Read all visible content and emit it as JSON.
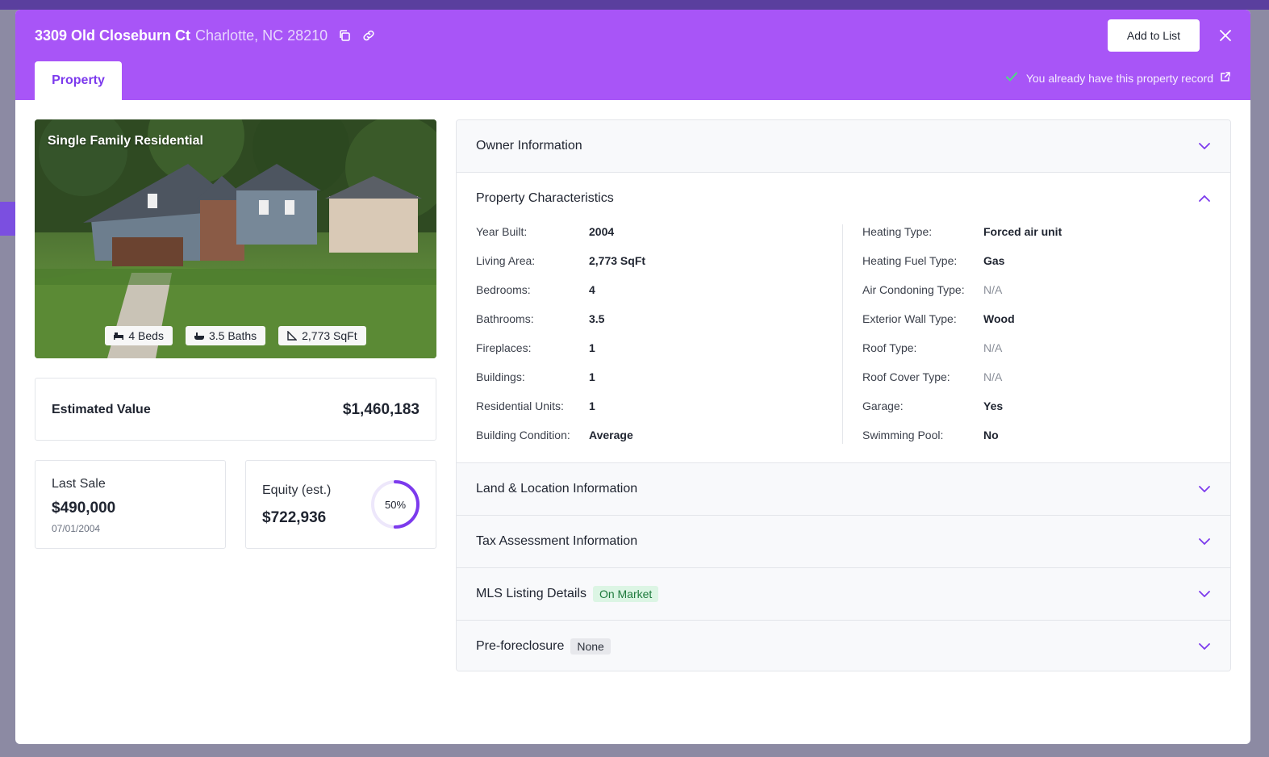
{
  "header": {
    "address": "3309 Old Closeburn Ct",
    "city_state_zip": "Charlotte, NC 28210",
    "add_to_list_label": "Add to List",
    "tab_property": "Property",
    "record_note": "You already have this property record",
    "colors": {
      "header_bg": "#a855f7",
      "accent": "#7c3aed"
    }
  },
  "photo": {
    "type_label": "Single Family Residential",
    "beds": "4 Beds",
    "baths": "3.5 Baths",
    "sqft": "2,773 SqFt"
  },
  "estimated": {
    "label": "Estimated Value",
    "value": "$1,460,183"
  },
  "last_sale": {
    "label": "Last Sale",
    "value": "$490,000",
    "date": "07/01/2004"
  },
  "equity": {
    "label": "Equity (est.)",
    "value": "$722,936",
    "percent_label": "50%",
    "percent": 50
  },
  "sections": {
    "owner": "Owner Information",
    "characteristics": "Property Characteristics",
    "land": "Land & Location Information",
    "tax": "Tax Assessment Information",
    "mls": "MLS Listing Details",
    "mls_badge": "On Market",
    "preforeclosure": "Pre-foreclosure",
    "preforeclosure_badge": "None"
  },
  "characteristics_left": [
    {
      "key": "Year Built:",
      "value": "2004"
    },
    {
      "key": "Living Area:",
      "value": "2,773 SqFt"
    },
    {
      "key": "Bedrooms:",
      "value": "4"
    },
    {
      "key": "Bathrooms:",
      "value": "3.5"
    },
    {
      "key": "Fireplaces:",
      "value": "1"
    },
    {
      "key": "Buildings:",
      "value": "1"
    },
    {
      "key": "Residential Units:",
      "value": "1"
    },
    {
      "key": "Building Condition:",
      "value": "Average"
    }
  ],
  "characteristics_right": [
    {
      "key": "Heating Type:",
      "value": "Forced air unit"
    },
    {
      "key": "Heating Fuel Type:",
      "value": "Gas"
    },
    {
      "key": "Air Condoning Type:",
      "value": "N/A"
    },
    {
      "key": "Exterior Wall Type:",
      "value": "Wood"
    },
    {
      "key": "Roof Type:",
      "value": "N/A"
    },
    {
      "key": "Roof Cover Type:",
      "value": "N/A"
    },
    {
      "key": "Garage:",
      "value": "Yes"
    },
    {
      "key": "Swimming Pool:",
      "value": "No"
    }
  ]
}
